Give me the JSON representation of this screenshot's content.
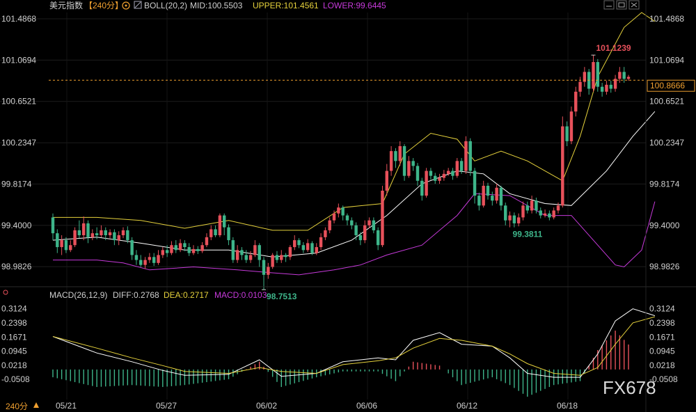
{
  "header": {
    "symbol": "美元指数",
    "period": "【240分】",
    "boll_label": "BOLL(20,2)",
    "mid": "MID:100.5503",
    "upper": "UPPER:101.4561",
    "lower": "LOWER:99.6445"
  },
  "macd_header": {
    "label": "MACD(26,12,9)",
    "diff": "DIFF:0.2768",
    "dea": "DEA:0.2717",
    "macd": "MACD:0.0103"
  },
  "footer": {
    "period": "240分",
    "watermark": "FX678"
  },
  "colors": {
    "up": "#e8515b",
    "down": "#3eb58a",
    "mid": "#ffffff",
    "upper": "#e6d23c",
    "lower": "#c73adb",
    "diff": "#ffffff",
    "dea": "#e6d23c",
    "current": "#f0a030",
    "hist_up": "#e8515b",
    "hist_down": "#3eb58a"
  },
  "chart_data": [
    {
      "type": "candlestick",
      "title": "美元指数 240分 BOLL(20,2)",
      "y_ticks": [
        "101.4868",
        "101.0694",
        "100.6521",
        "100.2347",
        "99.8174",
        "99.4000",
        "98.9826"
      ],
      "ylim": [
        98.85,
        101.55
      ],
      "x_ticks": [
        "05/21",
        "05/27",
        "06/02",
        "06/06",
        "06/12",
        "06/18"
      ],
      "current_price": "100.8666",
      "annotations": {
        "high": "101.1239",
        "low": "98.7513",
        "mid_low": "99.3811"
      },
      "candles": [
        [
          99.48,
          99.32,
          99.52,
          99.25
        ],
        [
          99.32,
          99.18,
          99.36,
          99.12
        ],
        [
          99.18,
          99.25,
          99.3,
          99.1
        ],
        [
          99.25,
          99.15,
          99.28,
          99.12
        ],
        [
          99.15,
          99.2,
          99.25,
          99.13
        ],
        [
          99.2,
          99.35,
          99.38,
          99.18
        ],
        [
          99.35,
          99.3,
          99.45,
          99.27
        ],
        [
          99.3,
          99.42,
          99.49,
          99.25
        ],
        [
          99.42,
          99.28,
          99.45,
          99.22
        ],
        [
          99.28,
          99.32,
          99.36,
          99.25
        ],
        [
          99.32,
          99.3,
          99.38,
          99.26
        ],
        [
          99.3,
          99.35,
          99.4,
          99.28
        ],
        [
          99.35,
          99.3,
          99.38,
          99.25
        ],
        [
          99.3,
          99.33,
          99.36,
          99.27
        ],
        [
          99.33,
          99.25,
          99.36,
          99.2
        ],
        [
          99.25,
          99.3,
          99.34,
          99.2
        ],
        [
          99.3,
          99.35,
          99.38,
          99.27
        ],
        [
          99.35,
          99.25,
          99.39,
          99.22
        ],
        [
          99.25,
          99.1,
          99.28,
          99.05
        ],
        [
          99.1,
          99.05,
          99.15,
          99.0
        ],
        [
          99.05,
          99.0,
          99.1,
          98.98
        ],
        [
          99.0,
          99.05,
          99.08,
          98.96
        ],
        [
          99.05,
          99.08,
          99.12,
          99.02
        ],
        [
          99.08,
          99.02,
          99.12,
          98.99
        ],
        [
          99.02,
          99.1,
          99.15,
          99.0
        ],
        [
          99.1,
          99.15,
          99.18,
          99.07
        ],
        [
          99.15,
          99.12,
          99.2,
          99.08
        ],
        [
          99.12,
          99.2,
          99.24,
          99.1
        ],
        [
          99.2,
          99.15,
          99.25,
          99.12
        ],
        [
          99.15,
          99.22,
          99.26,
          99.13
        ],
        [
          99.22,
          99.18,
          99.25,
          99.14
        ],
        [
          99.18,
          99.12,
          99.22,
          99.09
        ],
        [
          99.12,
          99.16,
          99.2,
          99.1
        ],
        [
          99.16,
          99.14,
          99.19,
          99.11
        ],
        [
          99.14,
          99.2,
          99.23,
          99.12
        ],
        [
          99.2,
          99.28,
          99.32,
          99.18
        ],
        [
          99.28,
          99.36,
          99.4,
          99.25
        ],
        [
          99.36,
          99.3,
          99.4,
          99.28
        ],
        [
          99.3,
          99.5,
          99.52,
          99.28
        ],
        [
          99.5,
          99.38,
          99.52,
          99.3
        ],
        [
          99.38,
          99.25,
          99.41,
          99.2
        ],
        [
          99.25,
          99.05,
          99.28,
          99.02
        ],
        [
          99.05,
          99.15,
          99.2,
          99.02
        ],
        [
          99.15,
          99.1,
          99.18,
          99.05
        ],
        [
          99.1,
          99.05,
          99.15,
          99.02
        ],
        [
          99.05,
          99.1,
          99.14,
          99.02
        ],
        [
          99.1,
          99.2,
          99.25,
          99.08
        ],
        [
          99.2,
          99.05,
          99.22,
          98.98
        ],
        [
          99.05,
          98.9,
          99.08,
          98.75
        ],
        [
          98.9,
          98.98,
          99.02,
          98.86
        ],
        [
          98.98,
          99.1,
          99.12,
          98.96
        ],
        [
          99.1,
          99.05,
          99.14,
          99.02
        ],
        [
          99.05,
          99.1,
          99.15,
          99.02
        ],
        [
          99.1,
          99.08,
          99.12,
          99.03
        ],
        [
          99.08,
          99.18,
          99.2,
          99.05
        ],
        [
          99.18,
          99.25,
          99.3,
          99.15
        ],
        [
          99.25,
          99.2,
          99.27,
          99.17
        ],
        [
          99.2,
          99.15,
          99.23,
          99.12
        ],
        [
          99.15,
          99.22,
          99.26,
          99.13
        ],
        [
          99.22,
          99.12,
          99.24,
          99.1
        ],
        [
          99.12,
          99.18,
          99.22,
          99.1
        ],
        [
          99.18,
          99.28,
          99.32,
          99.15
        ],
        [
          99.28,
          99.35,
          99.38,
          99.25
        ],
        [
          99.35,
          99.45,
          99.48,
          99.32
        ],
        [
          99.45,
          99.52,
          99.55,
          99.42
        ],
        [
          99.52,
          99.58,
          99.62,
          99.48
        ],
        [
          99.58,
          99.5,
          99.6,
          99.45
        ],
        [
          99.5,
          99.45,
          99.52,
          99.4
        ],
        [
          99.45,
          99.4,
          99.48,
          99.36
        ],
        [
          99.4,
          99.3,
          99.43,
          99.25
        ],
        [
          99.3,
          99.25,
          99.33,
          99.2
        ],
        [
          99.25,
          99.4,
          99.45,
          99.22
        ],
        [
          99.4,
          99.45,
          99.48,
          99.37
        ],
        [
          99.45,
          99.35,
          99.48,
          99.32
        ],
        [
          99.35,
          99.2,
          99.38,
          99.15
        ],
        [
          99.2,
          99.75,
          99.8,
          99.18
        ],
        [
          99.75,
          99.95,
          100.02,
          99.7
        ],
        [
          99.95,
          100.15,
          100.2,
          99.9
        ],
        [
          100.15,
          100.05,
          100.18,
          99.98
        ],
        [
          100.05,
          100.2,
          100.25,
          100.0
        ],
        [
          100.2,
          99.9,
          100.22,
          99.85
        ],
        [
          99.9,
          100.05,
          100.1,
          99.88
        ],
        [
          100.05,
          100.0,
          100.08,
          99.95
        ],
        [
          100.0,
          99.85,
          100.03,
          99.8
        ],
        [
          99.85,
          99.7,
          99.88,
          99.65
        ],
        [
          99.7,
          99.95,
          99.98,
          99.68
        ],
        [
          99.95,
          99.9,
          99.98,
          99.86
        ],
        [
          99.9,
          99.85,
          99.93,
          99.82
        ],
        [
          99.85,
          99.88,
          99.92,
          99.82
        ],
        [
          99.88,
          99.92,
          99.96,
          99.85
        ],
        [
          99.92,
          99.95,
          99.98,
          99.9
        ],
        [
          99.95,
          99.9,
          99.98,
          99.86
        ],
        [
          99.9,
          100.05,
          100.08,
          99.88
        ],
        [
          100.05,
          99.95,
          100.08,
          99.92
        ],
        [
          99.95,
          100.25,
          100.3,
          99.92
        ],
        [
          100.25,
          99.95,
          100.28,
          99.9
        ],
        [
          99.95,
          99.7,
          99.98,
          99.62
        ],
        [
          99.7,
          99.6,
          99.73,
          99.55
        ],
        [
          99.6,
          99.8,
          99.85,
          99.58
        ],
        [
          99.8,
          99.7,
          99.83,
          99.66
        ],
        [
          99.7,
          99.65,
          99.74,
          99.6
        ],
        [
          99.65,
          99.78,
          99.82,
          99.62
        ],
        [
          99.78,
          99.6,
          99.8,
          99.55
        ],
        [
          99.6,
          99.45,
          99.63,
          99.4
        ],
        [
          99.45,
          99.5,
          99.54,
          99.38
        ],
        [
          99.5,
          99.42,
          99.53,
          99.38
        ],
        [
          99.42,
          99.48,
          99.52,
          99.39
        ],
        [
          99.48,
          99.6,
          99.64,
          99.45
        ],
        [
          99.6,
          99.55,
          99.64,
          99.52
        ],
        [
          99.55,
          99.65,
          99.7,
          99.52
        ],
        [
          99.65,
          99.55,
          99.68,
          99.52
        ],
        [
          99.55,
          99.5,
          99.58,
          99.47
        ],
        [
          99.5,
          99.52,
          99.56,
          99.48
        ],
        [
          99.52,
          99.48,
          99.55,
          99.45
        ],
        [
          99.48,
          99.55,
          99.58,
          99.46
        ],
        [
          99.55,
          99.6,
          99.63,
          99.52
        ],
        [
          99.6,
          100.4,
          100.5,
          99.58
        ],
        [
          100.4,
          100.25,
          100.45,
          100.2
        ],
        [
          100.25,
          100.55,
          100.6,
          100.22
        ],
        [
          100.55,
          100.75,
          100.8,
          100.5
        ],
        [
          100.75,
          100.85,
          100.9,
          100.7
        ],
        [
          100.85,
          100.95,
          101.0,
          100.8
        ],
        [
          100.95,
          100.78,
          100.98,
          100.72
        ],
        [
          100.78,
          101.05,
          101.12,
          100.75
        ],
        [
          101.05,
          100.8,
          101.08,
          100.75
        ],
        [
          100.8,
          100.75,
          100.84,
          100.7
        ],
        [
          100.75,
          100.82,
          100.86,
          100.72
        ],
        [
          100.82,
          100.78,
          100.86,
          100.74
        ],
        [
          100.78,
          100.88,
          100.92,
          100.75
        ],
        [
          100.88,
          100.95,
          101.0,
          100.84
        ],
        [
          100.95,
          100.88,
          101.0,
          100.84
        ],
        [
          100.88,
          100.9,
          100.92,
          100.86
        ]
      ],
      "mid": [
        [
          0,
          99.25
        ],
        [
          10,
          99.28
        ],
        [
          20,
          99.22
        ],
        [
          30,
          99.15
        ],
        [
          40,
          99.15
        ],
        [
          50,
          99.08
        ],
        [
          60,
          99.12
        ],
        [
          68,
          99.25
        ],
        [
          76,
          99.5
        ],
        [
          84,
          99.82
        ],
        [
          92,
          99.95
        ],
        [
          98,
          99.92
        ],
        [
          104,
          99.72
        ],
        [
          112,
          99.62
        ],
        [
          118,
          99.6
        ],
        [
          126,
          99.95
        ],
        [
          132,
          100.3
        ],
        [
          137,
          100.55
        ]
      ],
      "upper": [
        [
          0,
          99.48
        ],
        [
          10,
          99.48
        ],
        [
          20,
          99.45
        ],
        [
          30,
          99.37
        ],
        [
          40,
          99.45
        ],
        [
          50,
          99.35
        ],
        [
          58,
          99.35
        ],
        [
          66,
          99.58
        ],
        [
          75,
          99.62
        ],
        [
          80,
          100.12
        ],
        [
          86,
          100.33
        ],
        [
          92,
          100.27
        ],
        [
          96,
          100.05
        ],
        [
          102,
          100.15
        ],
        [
          108,
          100.05
        ],
        [
          116,
          99.85
        ],
        [
          120,
          100.3
        ],
        [
          124,
          100.9
        ],
        [
          130,
          101.4
        ],
        [
          134,
          101.55
        ],
        [
          137,
          101.46
        ]
      ],
      "lower": [
        [
          0,
          99.05
        ],
        [
          10,
          99.05
        ],
        [
          16,
          99.02
        ],
        [
          22,
          98.95
        ],
        [
          32,
          98.98
        ],
        [
          42,
          98.95
        ],
        [
          50,
          98.92
        ],
        [
          56,
          98.9
        ],
        [
          64,
          98.95
        ],
        [
          70,
          99.0
        ],
        [
          76,
          99.1
        ],
        [
          84,
          99.2
        ],
        [
          92,
          99.5
        ],
        [
          96,
          99.72
        ],
        [
          104,
          99.7
        ],
        [
          112,
          99.5
        ],
        [
          118,
          99.5
        ],
        [
          124,
          99.2
        ],
        [
          128,
          99.0
        ],
        [
          130,
          98.98
        ],
        [
          134,
          99.15
        ],
        [
          137,
          99.64
        ]
      ]
    },
    {
      "type": "macd",
      "title": "MACD(26,12,9)",
      "y_ticks": [
        "0.3124",
        "0.2398",
        "0.1671",
        "0.0945",
        "0.0218",
        "-0.0508"
      ],
      "ylim": [
        -0.14,
        0.34
      ],
      "diff": [
        [
          0,
          0.17
        ],
        [
          10,
          0.085
        ],
        [
          18,
          0.04
        ],
        [
          25,
          -0.005
        ],
        [
          30,
          -0.03
        ],
        [
          40,
          -0.025
        ],
        [
          47,
          0.05
        ],
        [
          52,
          -0.035
        ],
        [
          60,
          -0.02
        ],
        [
          66,
          0.04
        ],
        [
          74,
          0.06
        ],
        [
          78,
          0.05
        ],
        [
          82,
          0.15
        ],
        [
          88,
          0.19
        ],
        [
          93,
          0.13
        ],
        [
          100,
          0.12
        ],
        [
          104,
          0.06
        ],
        [
          108,
          -0.02
        ],
        [
          114,
          -0.04
        ],
        [
          120,
          -0.04
        ],
        [
          124,
          0.08
        ],
        [
          128,
          0.25
        ],
        [
          132,
          0.3124
        ],
        [
          137,
          0.2768
        ]
      ],
      "dea": [
        [
          0,
          0.17
        ],
        [
          10,
          0.11
        ],
        [
          18,
          0.06
        ],
        [
          25,
          0.02
        ],
        [
          30,
          -0.01
        ],
        [
          40,
          -0.02
        ],
        [
          47,
          0.01
        ],
        [
          52,
          -0.01
        ],
        [
          60,
          -0.02
        ],
        [
          66,
          0.025
        ],
        [
          74,
          0.045
        ],
        [
          78,
          0.06
        ],
        [
          82,
          0.11
        ],
        [
          88,
          0.16
        ],
        [
          93,
          0.15
        ],
        [
          100,
          0.12
        ],
        [
          104,
          0.08
        ],
        [
          108,
          0.03
        ],
        [
          114,
          -0.02
        ],
        [
          120,
          -0.03
        ],
        [
          124,
          0.01
        ],
        [
          128,
          0.13
        ],
        [
          132,
          0.24
        ],
        [
          137,
          0.2717
        ]
      ]
    }
  ]
}
